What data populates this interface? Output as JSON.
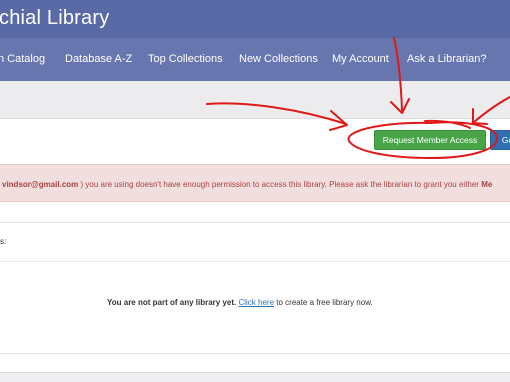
{
  "header": {
    "title": "chial Library"
  },
  "nav": {
    "items": [
      {
        "label": "n Catalog"
      },
      {
        "label": "Database A-Z"
      },
      {
        "label": "Top Collections"
      },
      {
        "label": "New Collections"
      },
      {
        "label": "My Account"
      },
      {
        "label": "Ask a Librarian?"
      }
    ]
  },
  "actions": {
    "request_access_label": "Request Member Access",
    "go_label": "Go"
  },
  "alert": {
    "email": "vindsor@gmail.com",
    "message": " ) you are using doesn't have enough permission to access this library. Please ask the librarian to grant you either ",
    "trailing_bold": "Me"
  },
  "library_section": {
    "label": "s:",
    "empty_bold": "You are not part of any library yet.",
    "link_text": "Click here",
    "empty_suffix": " to create a free library now."
  },
  "colors": {
    "header_bg": "#5a6aa6",
    "nav_bg": "#6776ae",
    "request_button": "#47a447",
    "go_button": "#2f6fb2",
    "alert_bg": "#f1dede",
    "alert_text": "#a94442",
    "annotation": "#e01818"
  }
}
